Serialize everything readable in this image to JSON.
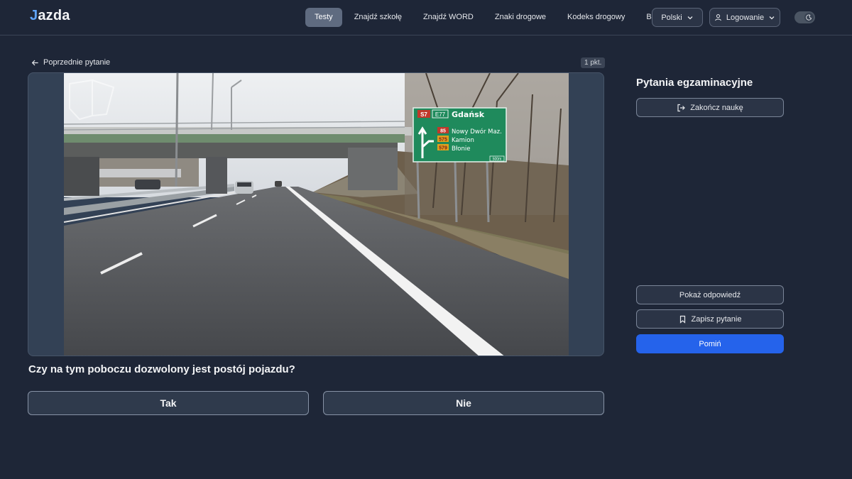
{
  "app": {
    "logo_prefix": "J",
    "logo_rest": "azda"
  },
  "nav": {
    "items": [
      "Testy",
      "Znajdź szkołę",
      "Znajdź WORD",
      "Znaki drogowe",
      "Kodeks drogowy",
      "Blog"
    ],
    "active_index": 0,
    "language": "Polski",
    "login": "Logowanie"
  },
  "theme_toggle": {
    "icon": "moon-icon"
  },
  "question": {
    "back_label": "Poprzednie pytanie",
    "points": "1 pkt.",
    "text": "Czy na tym poboczu dozwolony jest postój pojazdu?",
    "answers": [
      "Tak",
      "Nie"
    ]
  },
  "sign": {
    "route1": "S7",
    "route2": "E77",
    "destination": "Gdańsk",
    "rows": [
      {
        "badge": "85",
        "text": "Nowy Dwór Maz."
      },
      {
        "badge": "575",
        "text": "Kamion"
      },
      {
        "badge": "579",
        "text": "Błonie"
      }
    ],
    "distance": "500m"
  },
  "sidebar": {
    "title": "Pytania egzaminacyjne",
    "end_label": "Zakończ naukę",
    "show_answer_label": "Pokaż odpowiedź",
    "save_label": "Zapisz pytanie",
    "skip_label": "Pomiń"
  },
  "colors": {
    "accent": "#2563eb",
    "background": "#1e2637",
    "sign_green": "#1f8a5c"
  }
}
